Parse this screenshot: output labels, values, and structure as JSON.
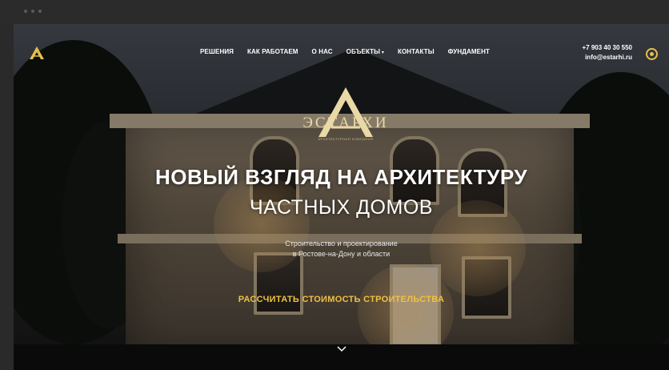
{
  "brand": {
    "name": "ЭСТАРХИ",
    "tagline": "АРХИТЕКТУРНАЯ КОМПАНИЯ",
    "accent_color": "#f0c040",
    "logo_icon": "triangle-logo-icon"
  },
  "nav": {
    "items": [
      {
        "label": "РЕШЕНИЯ"
      },
      {
        "label": "КАК РАБОТАЕМ"
      },
      {
        "label": "О НАС"
      },
      {
        "label": "ОБЪЕКТЫ",
        "has_dropdown": true
      },
      {
        "label": "КОНТАКТЫ"
      },
      {
        "label": "ФУНДАМЕНТ"
      }
    ]
  },
  "contacts": {
    "phone": "+7 903 40 30 550",
    "email": "info@estarhi.ru"
  },
  "hero": {
    "headline": "НОВЫЙ ВЗГЛЯД НА АРХИТЕКТУРУ",
    "subheadline": "ЧАСТНЫХ ДОМОВ",
    "desc_line1": "Строительство и проектирование",
    "desc_line2": "в Ростове-на-Дону и области",
    "cta_label": "РАССЧИТАТЬ СТОИМОСТЬ СТРОИТЕЛЬСТВА",
    "scroll_icon": "chevron-down-icon"
  }
}
